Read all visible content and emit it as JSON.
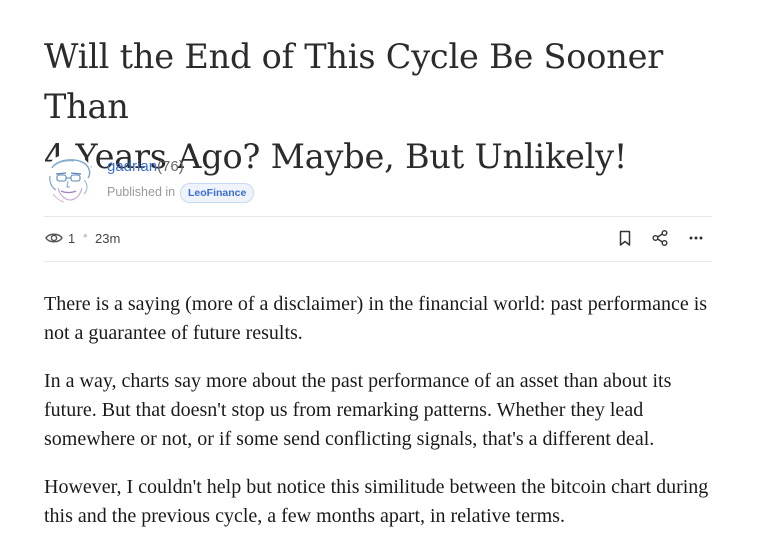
{
  "post": {
    "title_line1": "Will the End of This Cycle Be Sooner Than",
    "title_line2": "4 Years Ago? Maybe, But Unlikely!"
  },
  "author": {
    "name": "gadrian",
    "reputation": "(76)",
    "published_label": "Published in",
    "community": "LeoFinance"
  },
  "stats": {
    "views": "1",
    "separator": "•",
    "time_ago": "23m"
  },
  "icons": {
    "views": "eye-icon",
    "bookmark": "bookmark-icon",
    "share": "share-icon",
    "more": "more-icon"
  },
  "colors": {
    "link": "#3b6fd1",
    "badge_bg": "#eef3fc",
    "muted": "#9a9a9a"
  },
  "body": {
    "paragraphs": [
      "There is a saying (more of a disclaimer) in the financial world: past performance is not a guarantee of future results.",
      "In a way, charts say more about the past performance of an asset than about its future. But that doesn't stop us from remarking patterns. Whether they lead somewhere or not, or if some send conflicting signals, that's a different deal.",
      "However, I couldn't help but notice this similitude between the bitcoin chart during this and the previous cycle, a few months apart, in relative terms."
    ]
  }
}
